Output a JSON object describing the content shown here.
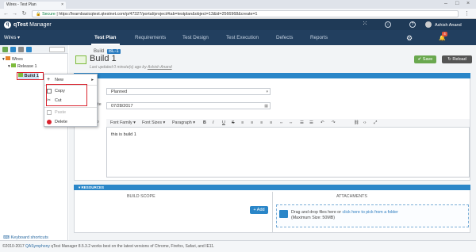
{
  "browser": {
    "tab_title": "Wires - Test Plan",
    "tab_close": "×",
    "url_secure": "Secure",
    "url": "https://learnbasicqtest.qtestnet.com/p/47327/portal/project#tab=testplan&object=13&id=2566968&create=1"
  },
  "app": {
    "brand_q": "qTest",
    "brand_rest": "Manager",
    "user_name": "Ashish Anand",
    "notif_count": "4",
    "project": "Wires ▾",
    "nav": [
      "Test Plan",
      "Requirements",
      "Test Design",
      "Test Execution",
      "Defects",
      "Reports"
    ]
  },
  "tree": {
    "root": "Wires",
    "release": "Release 1",
    "build": "Build 1",
    "keyboard_shortcuts": "Keyboard shortcuts"
  },
  "context_menu": {
    "new": "New",
    "copy": "Copy",
    "cut": "Cut",
    "paste": "Paste",
    "delete": "Delete"
  },
  "detail": {
    "type_label": "Build",
    "id_badge": "BL-1",
    "title": "Build 1",
    "updated": "Last updated 0 minute(s) ago by",
    "updated_by": "Ashish Anand",
    "save": "Save",
    "reload": "Reload",
    "props_header": "S",
    "status_value": "Planned",
    "date_label": "ate",
    "date_value": "07/28/2017",
    "desc_label": "to",
    "toolbar": [
      "Font Family ▾",
      "Font Sizes ▾",
      "Paragraph ▾",
      "B",
      "I",
      "U",
      "S",
      "≡",
      "≡",
      "≡",
      "≡",
      "⇔",
      "⇔",
      "☰",
      "☰",
      "↶",
      "↷",
      "⛓",
      "‹›",
      "⤢"
    ],
    "description": "this is build 1"
  },
  "resources": {
    "header": "▾ RESOURCES",
    "build_scope": "BUILD SCOPE",
    "attachments": "ATTACHMENTS",
    "add": "+ Add",
    "drop_text": "Drag and drop files here or",
    "drop_link": "click here to pick from a folder",
    "max_size": "(Maximum Size: 50MB)"
  },
  "footer": {
    "copyright": "©2010-2017",
    "company": "QASymphony",
    "version": "   qTest Manager 8.5.3.2 works best on the latest versions of Chrome, Firefox, Safari, and IE11."
  },
  "colors": {
    "header": "#1f3a57",
    "accent": "#2a86c8",
    "save": "#6aa84f",
    "highlight": "#d9232e"
  }
}
